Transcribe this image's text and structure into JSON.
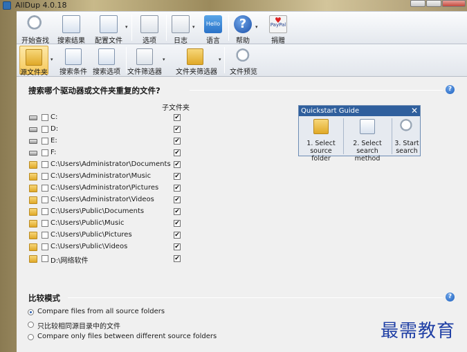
{
  "window": {
    "title": "AllDup 4.0.18"
  },
  "toolbar": {
    "items": [
      {
        "label": "开始查找",
        "icon": "magnifier-icon"
      },
      {
        "label": "搜索结果",
        "icon": "results-icon"
      },
      {
        "label": "配置文件",
        "icon": "profile-icon"
      },
      {
        "label": "选项",
        "icon": "options-icon"
      },
      {
        "label": "日志",
        "icon": "log-icon"
      },
      {
        "label": "语言",
        "icon": "hello-language-icon",
        "icon_text": "Hello"
      },
      {
        "label": "帮助",
        "icon": "help-icon",
        "icon_text": "?"
      },
      {
        "label": "捐赠",
        "icon": "paypal-donate-icon",
        "icon_text": "PayPal"
      }
    ]
  },
  "toolbar2": {
    "items": [
      {
        "label": "源文件夹",
        "icon": "source-folder-icon",
        "active": true
      },
      {
        "label": "搜索条件",
        "icon": "search-criteria-icon"
      },
      {
        "label": "搜索选项",
        "icon": "search-options-icon"
      },
      {
        "label": "文件筛选器",
        "icon": "file-filter-icon"
      },
      {
        "label": "文件夹筛选器",
        "icon": "folder-filter-icon"
      },
      {
        "label": "文件预览",
        "icon": "file-preview-icon"
      }
    ]
  },
  "source": {
    "heading": "搜索哪个驱动器或文件夹重复的文件?",
    "help": "?",
    "subfolder_header": "子文件夹",
    "check_mark": "✔",
    "rows": [
      {
        "path": "C:",
        "icon": "system-drive-icon",
        "checked": false,
        "subfolders": true
      },
      {
        "path": "D:",
        "icon": "drive-icon",
        "checked": false,
        "subfolders": true
      },
      {
        "path": "E:",
        "icon": "drive-icon",
        "checked": false,
        "subfolders": true
      },
      {
        "path": "F:",
        "icon": "drive-icon",
        "checked": false,
        "subfolders": true
      },
      {
        "path": "C:\\Users\\Administrator\\Documents",
        "icon": "documents-folder-icon",
        "checked": false,
        "subfolders": true
      },
      {
        "path": "C:\\Users\\Administrator\\Music",
        "icon": "music-folder-icon",
        "checked": false,
        "subfolders": true
      },
      {
        "path": "C:\\Users\\Administrator\\Pictures",
        "icon": "pictures-folder-icon",
        "checked": false,
        "subfolders": true
      },
      {
        "path": "C:\\Users\\Administrator\\Videos",
        "icon": "videos-folder-icon",
        "checked": false,
        "subfolders": true
      },
      {
        "path": "C:\\Users\\Public\\Documents",
        "icon": "folder-icon",
        "checked": false,
        "subfolders": true
      },
      {
        "path": "C:\\Users\\Public\\Music",
        "icon": "folder-icon",
        "checked": false,
        "subfolders": true
      },
      {
        "path": "C:\\Users\\Public\\Pictures",
        "icon": "folder-icon",
        "checked": false,
        "subfolders": true
      },
      {
        "path": "C:\\Users\\Public\\Videos",
        "icon": "folder-icon",
        "checked": false,
        "subfolders": true
      },
      {
        "path": "D:\\网络软件",
        "icon": "folder-icon",
        "checked": false,
        "subfolders": true
      }
    ]
  },
  "quickstart": {
    "title": "Quickstart Guide",
    "close": "✕",
    "steps": [
      {
        "label": "1. Select\nsource folder",
        "icon": "source-folder-icon"
      },
      {
        "label": "2. Select\nsearch method",
        "icon": "search-method-icon"
      },
      {
        "label": "3. Start\nsearch",
        "icon": "magnifier-icon"
      }
    ]
  },
  "compare": {
    "heading": "比较模式",
    "help": "?",
    "options": [
      {
        "label": "Compare files from all source folders",
        "selected": true
      },
      {
        "label": "只比较相同源目录中的文件",
        "selected": false
      },
      {
        "label": "Compare only files between different source folders",
        "selected": false
      }
    ]
  },
  "watermark": "最需教育",
  "colors": {
    "accent": "#2f5f9d",
    "active_tab": "#f6c85a",
    "help": "#1b5fbf"
  }
}
